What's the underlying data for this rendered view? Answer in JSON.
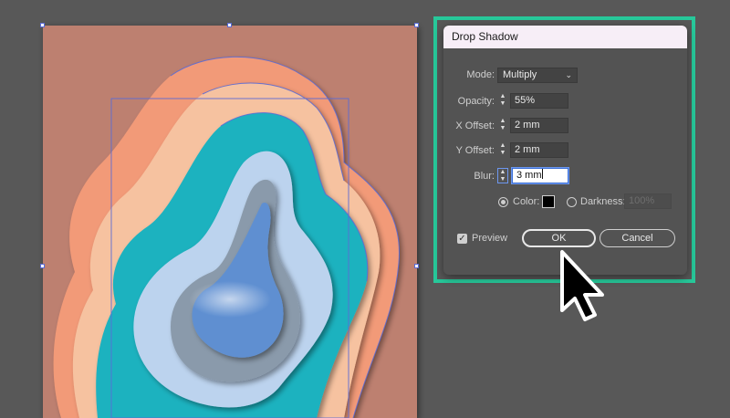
{
  "dialog": {
    "title": "Drop Shadow",
    "mode": {
      "label": "Mode:",
      "value": "Multiply"
    },
    "opacity": {
      "label": "Opacity:",
      "value": "55%"
    },
    "x_offset": {
      "label": "X Offset:",
      "value": "2 mm"
    },
    "y_offset": {
      "label": "Y Offset:",
      "value": "2 mm"
    },
    "blur": {
      "label": "Blur:",
      "value": "3 mm"
    },
    "color": {
      "label": "Color:",
      "selected": true,
      "swatch": "#000000"
    },
    "darkness": {
      "label": "Darkness:",
      "value": "100%",
      "enabled": false
    },
    "preview": {
      "label": "Preview",
      "checked": true
    },
    "ok_label": "OK",
    "cancel_label": "Cancel"
  },
  "colors": {
    "artboard": "#bd8070",
    "layer_outer": "#f29a78",
    "layer_peach": "#f6c2a0",
    "layer_teal": "#1ab2bf",
    "layer_lightblue": "#bcd3ee",
    "layer_grey": "#8a9aab",
    "layer_core": "#5f8fd1",
    "selection": "#5a6bd6",
    "highlight": "#27c89a"
  },
  "icons": {
    "cursor": "arrow-pointer-icon",
    "chevron": "chevron-down-icon",
    "spinner": "stepper-arrows-icon"
  }
}
